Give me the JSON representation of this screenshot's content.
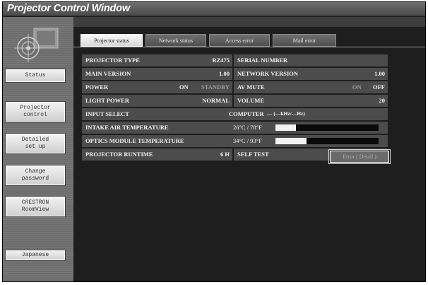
{
  "window": {
    "title": "Projector Control Window"
  },
  "sidebar": {
    "items": [
      {
        "label": "Status"
      },
      {
        "label": "Projector\ncontrol"
      },
      {
        "label": "Detailed\nset up"
      },
      {
        "label": "Change\npassword"
      },
      {
        "label": "CRESTRON\nRoomView"
      },
      {
        "label": "Japanese"
      }
    ]
  },
  "tabs": [
    {
      "label": "Projector status",
      "active": true
    },
    {
      "label": "Network status"
    },
    {
      "label": "Access error"
    },
    {
      "label": "Mail error"
    }
  ],
  "status": {
    "projector_type": {
      "label": "PROJECTOR TYPE",
      "value": "RZ475"
    },
    "serial_number": {
      "label": "SERIAL NUMBER",
      "value": ""
    },
    "main_version": {
      "label": "MAIN VERSION",
      "value": "1.00"
    },
    "network_version": {
      "label": "NETWORK VERSION",
      "value": "1.00"
    },
    "power": {
      "label": "POWER",
      "on": "ON",
      "standby": "STANDBY"
    },
    "av_mute": {
      "label": "AV MUTE",
      "on": "ON",
      "off": "OFF"
    },
    "light_power": {
      "label": "LIGHT POWER",
      "value": "NORMAL"
    },
    "volume": {
      "label": "VOLUME",
      "value": "20"
    },
    "input_select": {
      "label": "INPUT SELECT",
      "value": "COMPUTER",
      "freq": "--- (---kHz/---Hz)"
    },
    "intake_air_temp": {
      "label": "INTAKE AIR TEMPERATURE",
      "value": "26°C / 78°F",
      "level": 0.2
    },
    "optics_module_temp": {
      "label": "OPTICS MODULE TEMPERATURE",
      "value": "34°C / 93°F",
      "level": 0.3
    },
    "runtime": {
      "label": "PROJECTOR RUNTIME",
      "value": "6 H"
    },
    "self_test": {
      "label": "SELF TEST",
      "button": "Error ( Detail )"
    }
  }
}
